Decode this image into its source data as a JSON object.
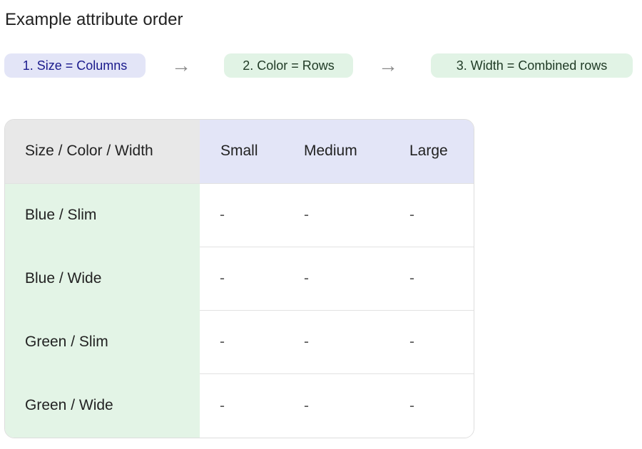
{
  "page": {
    "title": "Example attribute order"
  },
  "steps": [
    {
      "label": "1. Size = Columns",
      "color": "#e3e5f7",
      "text_color": "#1a1a8c"
    },
    {
      "label": "2. Color = Rows",
      "color": "#e1f3e5",
      "text_color": "#1f3a25"
    },
    {
      "label": "3. Width = Combined rows",
      "color": "#e1f3e5",
      "text_color": "#1f3a25"
    }
  ],
  "step_arrow": "→",
  "table": {
    "corner_header": "Size / Color / Width",
    "columns": [
      "Small",
      "Medium",
      "Large"
    ],
    "rows": [
      {
        "label": "Blue / Slim",
        "cells": [
          "-",
          "-",
          "-"
        ]
      },
      {
        "label": "Blue / Wide",
        "cells": [
          "-",
          "-",
          "-"
        ]
      },
      {
        "label": "Green / Slim",
        "cells": [
          "-",
          "-",
          "-"
        ]
      },
      {
        "label": "Green / Wide",
        "cells": [
          "-",
          "-",
          "-"
        ]
      }
    ]
  },
  "colors": {
    "column_header_bg": "#e3e5f7",
    "row_header_bg": "#e3f4e6",
    "corner_bg": "#e8e8e8"
  }
}
